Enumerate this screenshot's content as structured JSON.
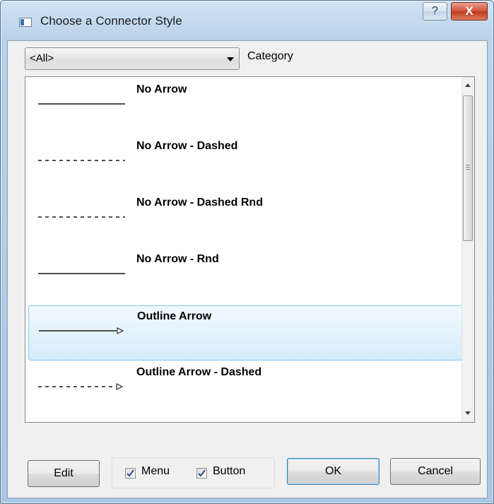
{
  "window": {
    "title": "Choose a Connector Style",
    "help_glyph": "?",
    "close_glyph": "X"
  },
  "filter": {
    "selected": "<All>",
    "label": "Category"
  },
  "styles": [
    {
      "name": "No Arrow",
      "line": "solid",
      "arrow": "none",
      "selected": false
    },
    {
      "name": "No Arrow - Dashed",
      "line": "dashed",
      "arrow": "none",
      "selected": false
    },
    {
      "name": "No Arrow - Dashed Rnd",
      "line": "dashed",
      "arrow": "none",
      "selected": false
    },
    {
      "name": "No Arrow - Rnd",
      "line": "solid",
      "arrow": "none",
      "selected": false
    },
    {
      "name": "Outline Arrow",
      "line": "solid",
      "arrow": "outline",
      "selected": true
    },
    {
      "name": "Outline Arrow - Dashed",
      "line": "dashed",
      "arrow": "outline",
      "selected": false
    }
  ],
  "buttons": {
    "edit": "Edit",
    "ok": "OK",
    "cancel": "Cancel"
  },
  "options": {
    "menu": {
      "label": "Menu",
      "checked": true
    },
    "button": {
      "label": "Button",
      "checked": true
    }
  },
  "colors": {
    "selection_border": "#84c6f0",
    "selection_fill": "#d6ecfb",
    "close_button": "#c1391f",
    "checkmark": "#2a4a9a"
  }
}
